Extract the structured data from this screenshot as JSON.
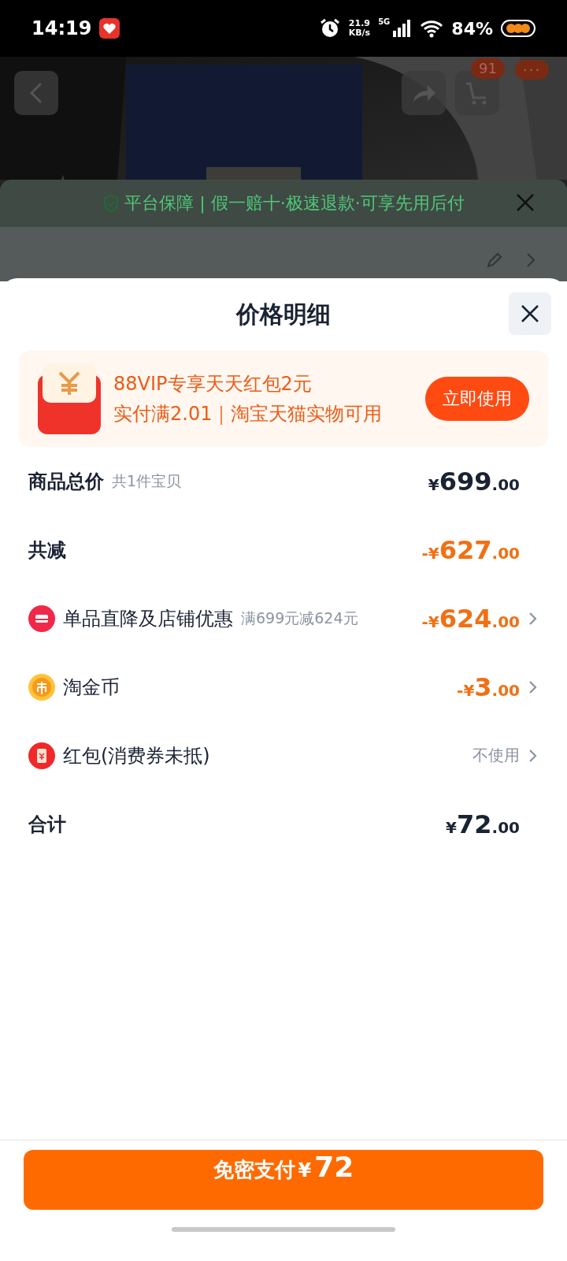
{
  "status_bar": {
    "time": "14:19",
    "net_speed": "21.9",
    "net_unit": "KB/s",
    "network": "5G",
    "battery": "84%"
  },
  "top_bar": {
    "cart_badge": "91",
    "more": "···"
  },
  "guarantee_banner": {
    "text": "平台保障 | 假一赔十·极速退款·可享先用后付"
  },
  "sheet": {
    "title": "价格明细",
    "promo": {
      "title": "88VIP专享天天红包2元",
      "subtitle": "实付满2.01｜淘宝天猫实物可用",
      "button": "立即使用"
    },
    "rows": [
      {
        "kind": "summary",
        "label": "商品总价",
        "note": "共1件宝贝",
        "amount": {
          "prefix": "¥",
          "integer": "699",
          "decimals": ".00"
        },
        "discount": false,
        "expandable": false
      },
      {
        "kind": "summary",
        "label": "共减",
        "amount": {
          "prefix": "-¥",
          "integer": "627",
          "decimals": ".00"
        },
        "discount": true,
        "expandable": false
      },
      {
        "kind": "shop",
        "label": "单品直降及店铺优惠",
        "note": "满699元减624元",
        "amount": {
          "prefix": "-¥",
          "integer": "624",
          "decimals": ".00"
        },
        "discount": true,
        "expandable": true
      },
      {
        "kind": "coin",
        "label": "淘金币",
        "amount": {
          "prefix": "-¥",
          "integer": "3",
          "decimals": ".00"
        },
        "discount": true,
        "expandable": true
      },
      {
        "kind": "red_packet",
        "label": "红包(消费券未抵)",
        "value": "不使用",
        "expandable": true
      },
      {
        "kind": "summary",
        "label": "合计",
        "amount": {
          "prefix": "¥",
          "integer": "72",
          "decimals": ".00"
        },
        "discount": false,
        "expandable": false
      }
    ],
    "pay_button": {
      "label": "免密支付",
      "prefix": "¥",
      "amount": "72"
    }
  }
}
